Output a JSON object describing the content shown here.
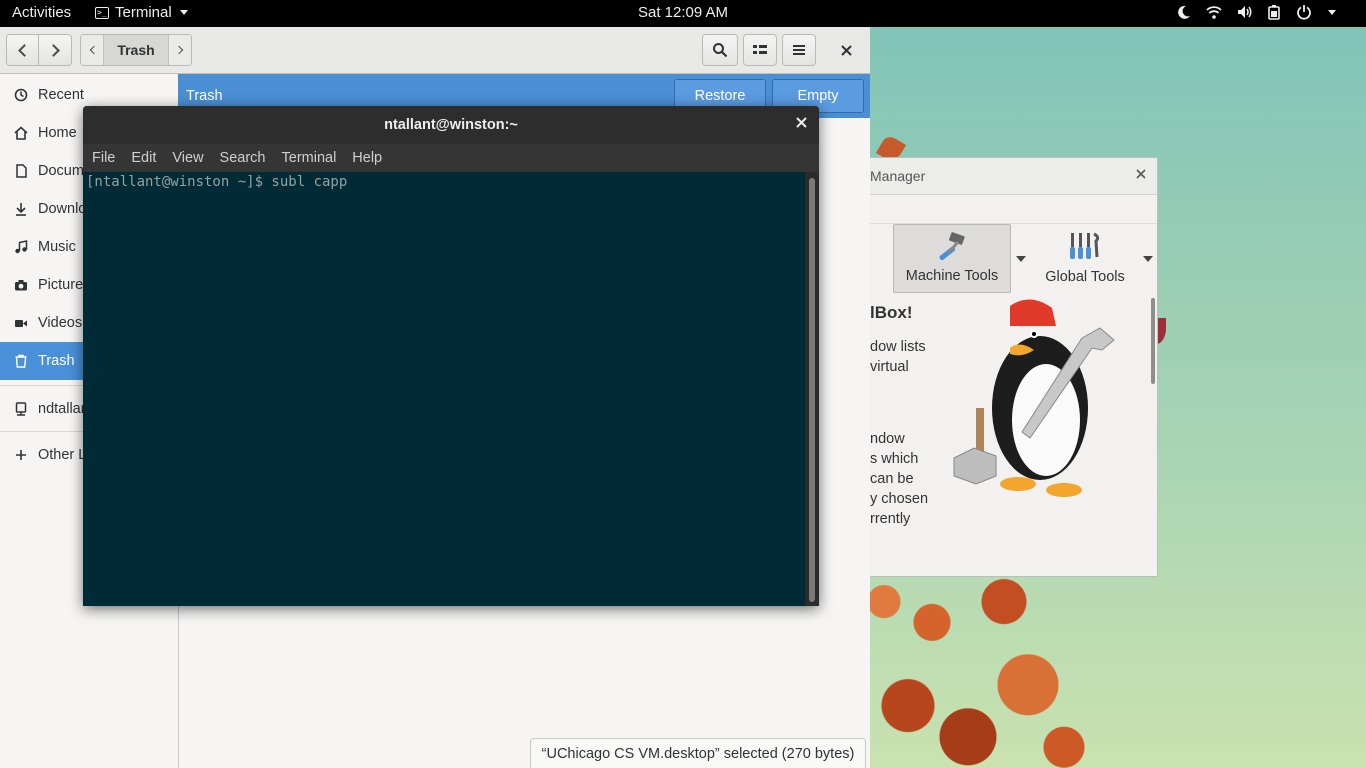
{
  "topbar": {
    "activities": "Activities",
    "app_name": "Terminal",
    "clock": "Sat 12:09 AM",
    "tray_icons": [
      "night-mode-icon",
      "wifi-icon",
      "volume-icon",
      "battery-icon",
      "power-icon"
    ]
  },
  "file_manager": {
    "current_location": "Trash",
    "sidebar": {
      "items": [
        {
          "label": "Recent",
          "icon": "recent-icon"
        },
        {
          "label": "Home",
          "icon": "home-icon"
        },
        {
          "label": "Docum",
          "icon": "documents-icon"
        },
        {
          "label": "Downlo",
          "icon": "downloads-icon"
        },
        {
          "label": "Music",
          "icon": "music-icon"
        },
        {
          "label": "Picture",
          "icon": "pictures-icon"
        },
        {
          "label": "Videos",
          "icon": "videos-icon"
        },
        {
          "label": "Trash",
          "icon": "trash-icon",
          "active": true
        },
        {
          "label": "ndtallan",
          "icon": "network-drive-icon"
        },
        {
          "label": "Other L",
          "icon": "plus-icon"
        }
      ]
    },
    "content_title": "Trash",
    "restore_label": "Restore",
    "empty_label": "Empty",
    "status": "“UChicago CS VM.desktop” selected  (270 bytes)",
    "accent_color": "#4a90d9"
  },
  "terminal": {
    "title": "ntallant@winston:~",
    "menu": [
      "File",
      "Edit",
      "View",
      "Search",
      "Terminal",
      "Help"
    ],
    "prompt_line": "[ntallant@winston ~]$ subl capp",
    "background_color": "#002b36"
  },
  "vbox": {
    "title_fragment": "Manager",
    "tools": [
      {
        "label": "Machine Tools",
        "icon": "machine-tools-icon",
        "selected": true
      },
      {
        "label": "Global Tools",
        "icon": "global-tools-icon",
        "selected": false
      }
    ],
    "heading_fragment": "lBox!",
    "text_lines_1": [
      "dow lists",
      "virtual"
    ],
    "text_lines_2": [
      "ndow",
      "s which",
      "can be",
      "y chosen",
      "rrently"
    ]
  }
}
